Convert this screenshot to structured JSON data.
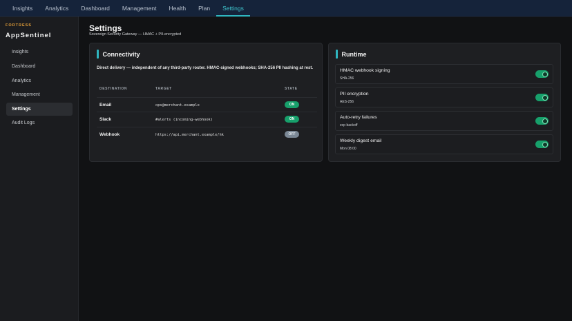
{
  "topnav": {
    "tabs": [
      {
        "label": "Insights"
      },
      {
        "label": "Analytics"
      },
      {
        "label": "Dashboard"
      },
      {
        "label": "Management"
      },
      {
        "label": "Health"
      },
      {
        "label": "Plan"
      },
      {
        "label": "Settings",
        "active": true
      }
    ]
  },
  "sidebar": {
    "kicker": "FORTRESS",
    "app_name": "AppSentinel",
    "items": [
      {
        "label": "Insights"
      },
      {
        "label": "Dashboard"
      },
      {
        "label": "Analytics"
      },
      {
        "label": "Management"
      },
      {
        "label": "Settings",
        "active": true
      },
      {
        "label": "Audit Logs"
      }
    ]
  },
  "page": {
    "title": "Settings",
    "subtitle": "Sovereign Security Gateway — HMAC + PII-encrypted"
  },
  "connectivity": {
    "title": "Connectivity",
    "description": "Direct delivery — independent of any third-party router. HMAC-signed webhooks; SHA-256 PII hashing at rest.",
    "columns": [
      "DESTINATION",
      "TARGET",
      "STATE"
    ],
    "rows": [
      {
        "destination": "Email",
        "target": "ops@merchant.example",
        "state": "ON"
      },
      {
        "destination": "Slack",
        "target": "#alerts (incoming-webhook)",
        "state": "ON"
      },
      {
        "destination": "Webhook",
        "target": "https://api.merchant.example/hk",
        "state": "OFF"
      }
    ]
  },
  "runtime": {
    "title": "Runtime",
    "items": [
      {
        "label": "HMAC webhook signing",
        "sub": "SHA-256",
        "enabled": true
      },
      {
        "label": "PII encryption",
        "sub": "AES-256",
        "enabled": true
      },
      {
        "label": "Auto-retry failures",
        "sub": "exp backoff",
        "enabled": true
      },
      {
        "label": "Weekly digest email",
        "sub": "Mon 08:00",
        "enabled": true
      }
    ]
  },
  "colors": {
    "accent": "#2fb6c0",
    "on": "#17a06b",
    "off": "#7b8896",
    "brand_kicker": "#e8a23a"
  }
}
